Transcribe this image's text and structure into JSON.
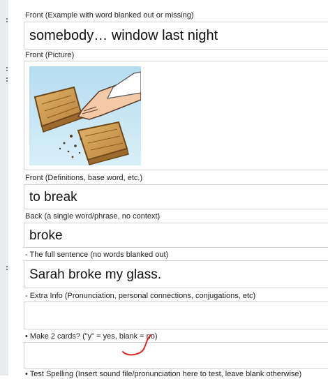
{
  "fields": [
    {
      "label": "Front (Example with word blanked out or missing)",
      "value": "somebody… window last night"
    },
    {
      "label": "Front (Picture)",
      "image_icon": "hand-breaking-board-image"
    },
    {
      "label": "Front (Definitions, base word, etc.)",
      "value": "to break"
    },
    {
      "label": "Back (a single word/phrase, no context)",
      "value": "broke"
    },
    {
      "label": "- The full sentence (no words blanked out)",
      "value": "Sarah broke my glass."
    },
    {
      "label": "- Extra Info (Pronunciation, personal connections, conjugations, etc)",
      "value": ""
    },
    {
      "label": "• Make 2 cards? (\"y\" = yes, blank = no)",
      "value": ""
    },
    {
      "label": "• Test Spelling (Insert sound file/pronunciation here to test, leave blank otherwise)",
      "value": ""
    }
  ],
  "colors": {
    "gutter": "#e9ecef",
    "border": "#cfd3d7",
    "annotation": "#e0242b"
  }
}
